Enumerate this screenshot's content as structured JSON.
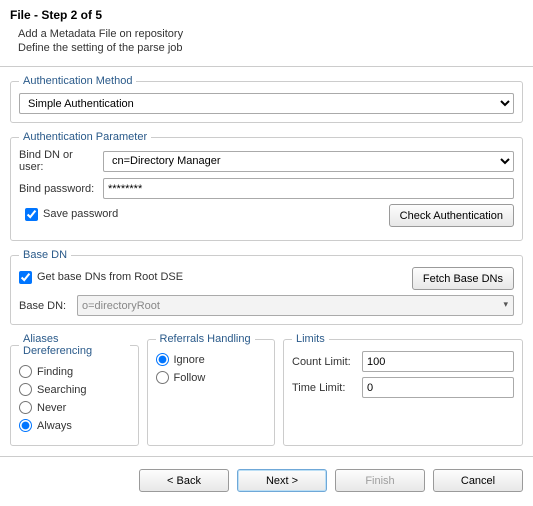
{
  "header": {
    "title": "File - Step 2 of 5",
    "line1": "Add a Metadata File on repository",
    "line2": "Define the setting of the parse job"
  },
  "authMethod": {
    "legend": "Authentication Method",
    "value": "Simple Authentication"
  },
  "authParam": {
    "legend": "Authentication Parameter",
    "bindDnLabel": "Bind DN or user:",
    "bindDnValue": "cn=Directory Manager",
    "bindPwLabel": "Bind password:",
    "bindPwMask": "********",
    "savePwLabel": "Save password",
    "savePwChecked": true,
    "checkBtn": "Check Authentication"
  },
  "baseDn": {
    "legend": "Base DN",
    "getLabel": "Get base DNs from Root DSE",
    "getChecked": true,
    "fetchBtn": "Fetch Base DNs",
    "fieldLabel": "Base DN:",
    "fieldValue": "o=directoryRoot"
  },
  "aliases": {
    "legend": "Aliases Dereferencing",
    "options": [
      "Finding",
      "Searching",
      "Never",
      "Always"
    ],
    "selected": "Always"
  },
  "referrals": {
    "legend": "Referrals Handling",
    "options": [
      "Ignore",
      "Follow"
    ],
    "selected": "Ignore"
  },
  "limits": {
    "legend": "Limits",
    "countLabel": "Count Limit:",
    "countValue": "100",
    "timeLabel": "Time Limit:",
    "timeValue": "0"
  },
  "footer": {
    "back": "< Back",
    "next": "Next >",
    "finish": "Finish",
    "cancel": "Cancel"
  }
}
